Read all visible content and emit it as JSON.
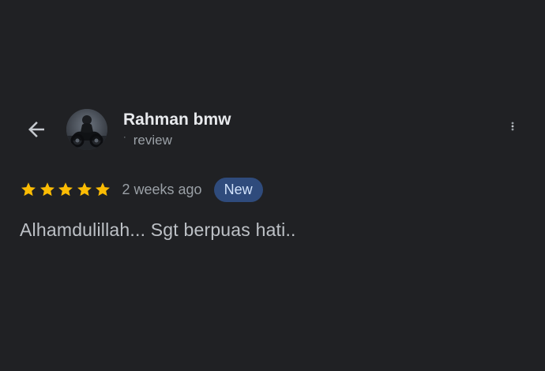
{
  "header": {
    "back_icon": "arrow-back-icon",
    "more_icon": "more-vert-icon"
  },
  "reviewer": {
    "name": "Rahman bmw",
    "review_count_mark": "·",
    "review_count_label": "review",
    "avatar_icon": "profile-photo"
  },
  "review": {
    "rating": 5,
    "rating_max": 5,
    "star_color": "#fbbc04",
    "date": "2 weeks ago",
    "badge": "New",
    "badge_color": "#2f4b7c",
    "text": "Alhamdulillah... Sgt berpuas hati.."
  }
}
